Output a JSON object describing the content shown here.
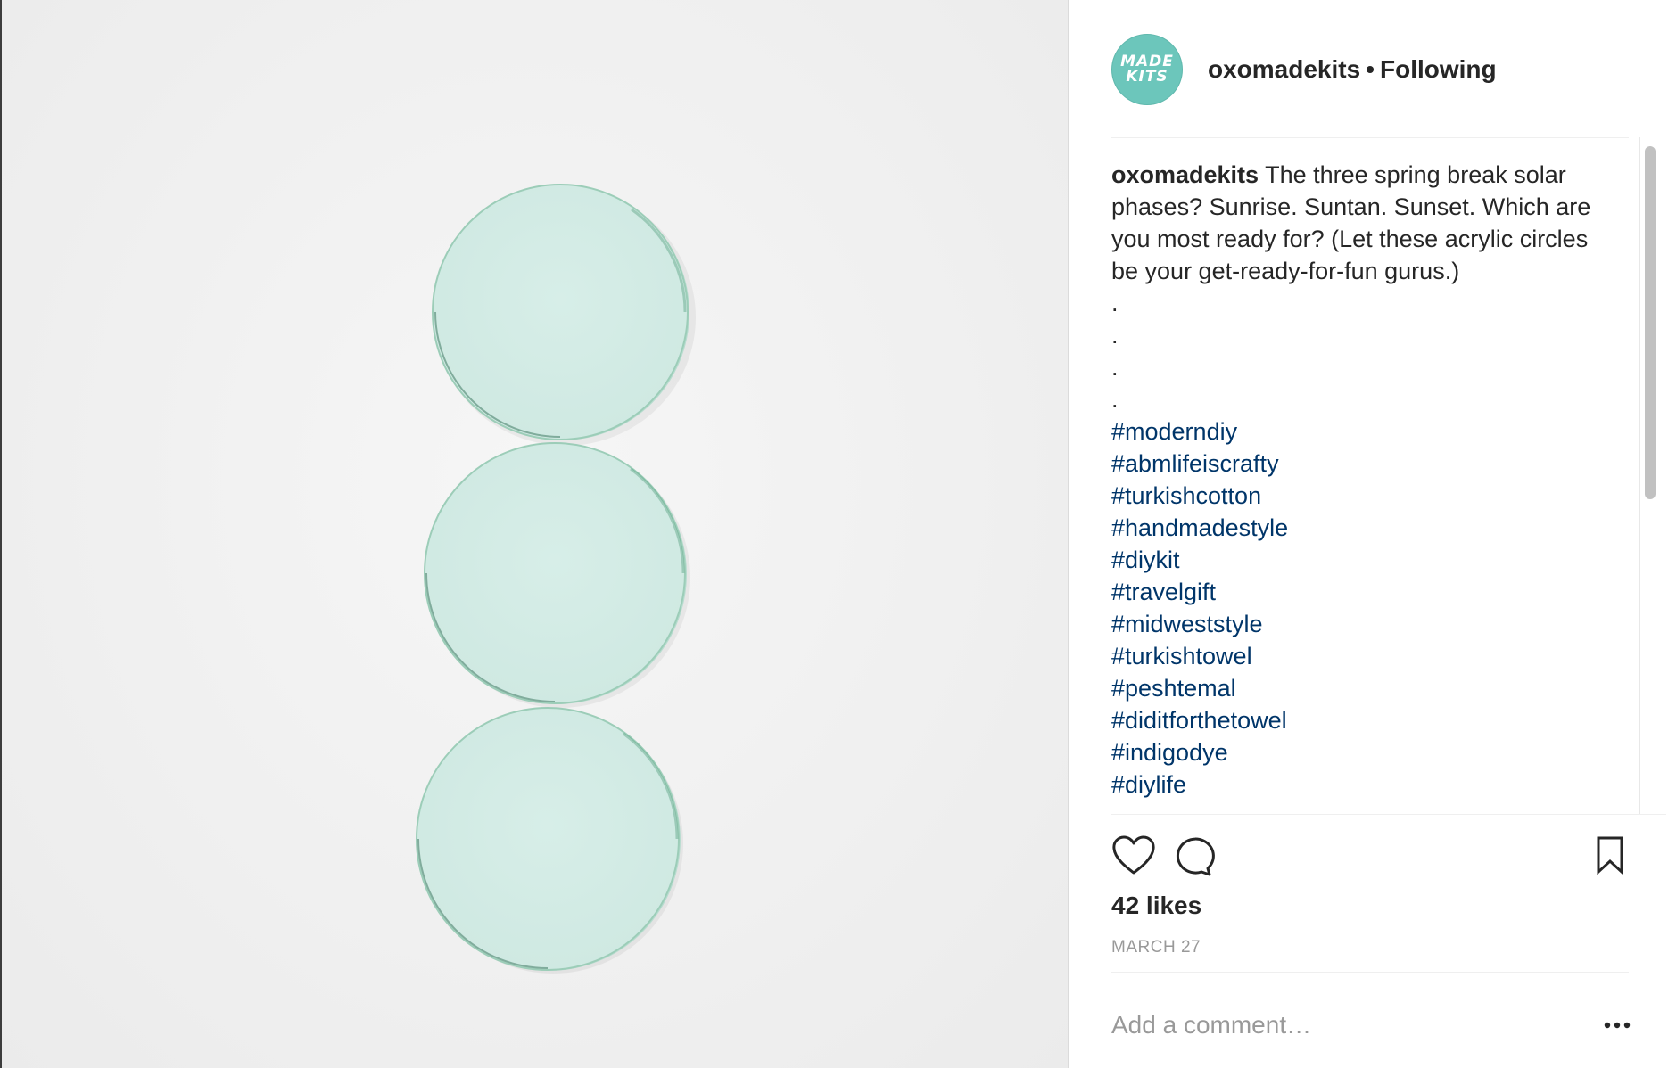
{
  "post": {
    "username": "oxomadekits",
    "separator": "•",
    "follow_status": "Following",
    "avatar_text_line1": "MADE",
    "avatar_text_line2": "KITS",
    "avatar_color": "#6cc6bb",
    "caption_user": "oxomadekits",
    "caption_text": "The three spring break solar phases? Sunrise. Suntan. Sunset. Which are you most ready for? (Let these acrylic circles be your get-ready-for-fun gurus.)",
    "caption_dots": [
      ".",
      ".",
      ".",
      "."
    ],
    "hashtags": [
      "#moderndiy",
      "#abmlifeiscrafty",
      "#turkishcotton",
      "#handmadestyle",
      "#diykit",
      "#travelgift",
      "#midweststyle",
      "#turkishtowel",
      "#peshtemal",
      "#diditforthetowel",
      "#indigodye",
      "#diylife"
    ],
    "hashtag_color": "#003569",
    "likes": "42 likes",
    "date": "MARCH 27",
    "comment_placeholder": "Add a comment…"
  },
  "icons": {
    "like": "heart-icon",
    "comment": "comment-bubble-icon",
    "save": "bookmark-icon",
    "more": "ellipsis-icon"
  },
  "photo": {
    "subject": "three mint acrylic circles",
    "circle_color": "#d4ece6"
  }
}
